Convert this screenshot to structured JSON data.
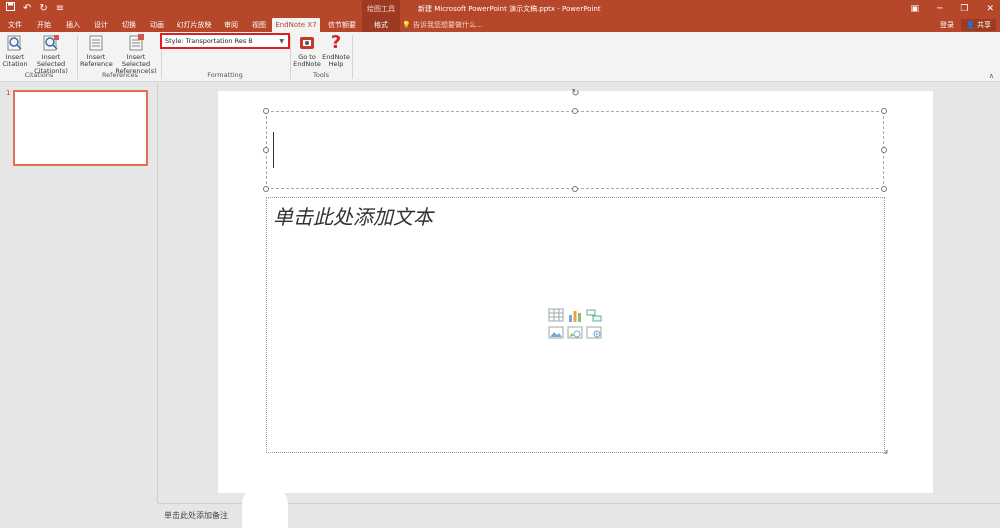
{
  "titlebar": {
    "context_group": "绘图工具",
    "window_title": "新建 Microsoft PowerPoint 演示文稿.pptx - PowerPoint",
    "qat_icons": [
      "save-icon",
      "undo-icon",
      "redo-icon",
      "customize-icon"
    ]
  },
  "tabs": [
    {
      "label": "文件",
      "state": "normal"
    },
    {
      "label": "开始",
      "state": "normal"
    },
    {
      "label": "插入",
      "state": "normal"
    },
    {
      "label": "设计",
      "state": "normal"
    },
    {
      "label": "切换",
      "state": "normal"
    },
    {
      "label": "动画",
      "state": "normal"
    },
    {
      "label": "幻灯片放映",
      "state": "normal"
    },
    {
      "label": "审阅",
      "state": "normal"
    },
    {
      "label": "视图",
      "state": "normal"
    },
    {
      "label": "EndNote X7",
      "state": "active"
    },
    {
      "label": "信节额要",
      "state": "normal"
    },
    {
      "label": "格式",
      "state": "context"
    }
  ],
  "tellme": "告诉我您想要做什么...",
  "account": {
    "login": "登录",
    "share": "共享"
  },
  "ribbon": {
    "insert_citation": {
      "line1": "Insert",
      "line2": "Citation"
    },
    "insert_selected_citation": {
      "line1": "Insert Selected",
      "line2": "Citation(s)"
    },
    "citations_group": "Citations",
    "insert_reference": {
      "line1": "Insert",
      "line2": "Reference"
    },
    "insert_selected_reference": {
      "line1": "Insert Selected",
      "line2": "Reference(s)"
    },
    "references_group": "References",
    "style_label": "Style:",
    "style_value": "Transportation Res B",
    "formatting_group": "Formatting",
    "goto_endnote": {
      "line1": "Go to",
      "line2": "EndNote"
    },
    "endnote_help": {
      "line1": "EndNote",
      "line2": "Help"
    },
    "tools_group": "Tools"
  },
  "slides": {
    "current_number": "1"
  },
  "slide": {
    "body_prompt": "单击此处添加文本"
  },
  "notes": {
    "placeholder": "单击此处添加备注"
  },
  "colors": {
    "accent": "#b7472a",
    "highlight": "#e02020"
  }
}
